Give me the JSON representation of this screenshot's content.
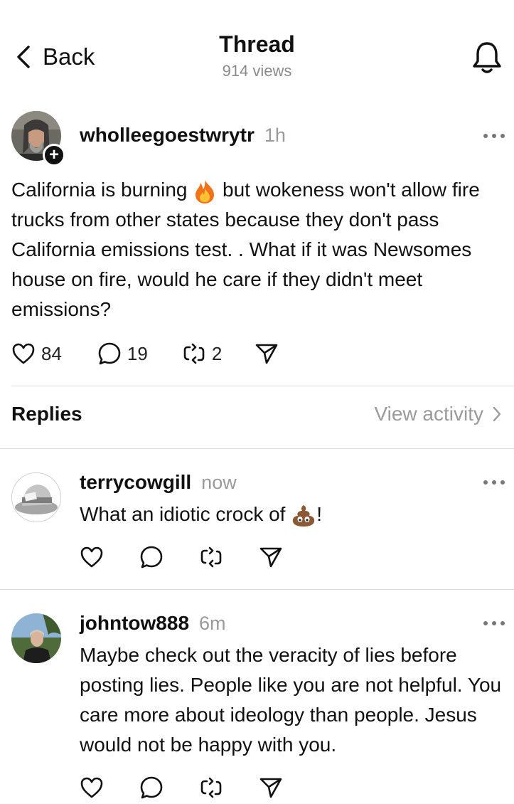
{
  "header": {
    "back_label": "Back",
    "title": "Thread",
    "views": "914 views"
  },
  "post": {
    "username": "wholleegoestwrytr",
    "time": "1h",
    "text_part1": "California is burning",
    "text_part2": "but wokeness won't allow fire trucks from other states because they don't pass California emissions test. . What if it was Newsomes house on fire, would he care if they didn't meet emissions?",
    "likes": "84",
    "comments": "19",
    "reposts": "2"
  },
  "replies_section": {
    "title": "Replies",
    "view_activity": "View activity"
  },
  "replies": [
    {
      "username": "terrycowgill",
      "time": "now",
      "text_part1": "What an idiotic crock of",
      "text_part2": "!"
    },
    {
      "username": "johntow888",
      "time": "6m",
      "text": "Maybe check out the veracity of lies before posting lies. People like you are not helpful. You care more about ideology than people. Jesus would not be happy with you."
    }
  ],
  "icons": {
    "back": "chevron-left-icon",
    "bell": "bell-icon",
    "like": "heart-icon",
    "comment": "speech-bubble-icon",
    "repost": "repost-icon",
    "share": "paper-plane-icon",
    "more": "more-dots-icon",
    "fire": "fire-emoji",
    "poop": "poop-emoji"
  },
  "colors": {
    "text": "#111111",
    "muted": "#9a9a9a",
    "divider": "#dcdcdc"
  }
}
